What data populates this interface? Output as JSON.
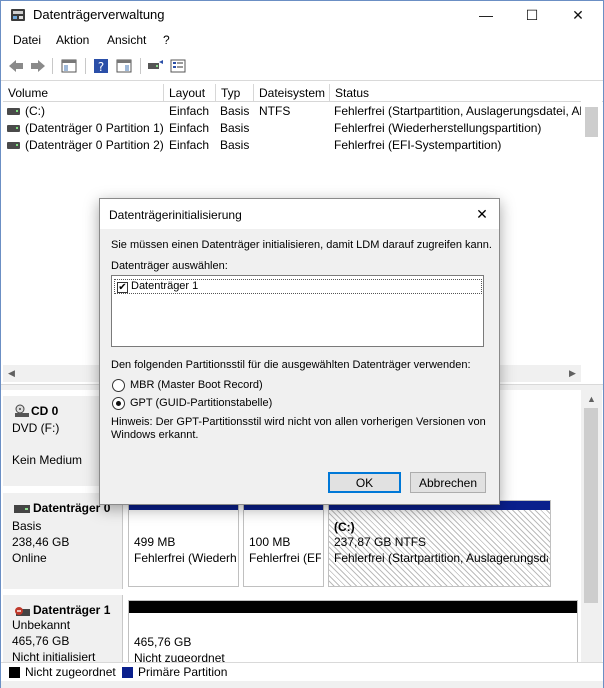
{
  "window": {
    "title": "Datenträgerverwaltung",
    "min_glyph": "—",
    "max_glyph": "☐",
    "close_glyph": "✕"
  },
  "menu": [
    "Datei",
    "Aktion",
    "Ansicht",
    "?"
  ],
  "toolbar_icons": [
    "back-icon",
    "forward-icon",
    "console-tree-icon",
    "help-icon",
    "properties-icon",
    "rescan-icon",
    "disk-list-icon"
  ],
  "table": {
    "columns": [
      "Volume",
      "Layout",
      "Typ",
      "Dateisystem",
      "Status"
    ],
    "rows": [
      [
        "(C:)",
        "Einfach",
        "Basis",
        "NTFS",
        "Fehlerfrei (Startpartition, Auslagerungsdatei, Absturzabbild, Primäre Partition)"
      ],
      [
        "(Datenträger 0 Partition 1)",
        "Einfach",
        "Basis",
        "",
        "Fehlerfrei (Wiederherstellungspartition)"
      ],
      [
        "(Datenträger 0 Partition 2)",
        "Einfach",
        "Basis",
        "",
        "Fehlerfrei (EFI-Systempartition)"
      ]
    ]
  },
  "disks": {
    "cd0": {
      "name": "CD 0",
      "lines": [
        "DVD (F:)",
        "",
        "Kein Medium"
      ]
    },
    "disk0": {
      "name": "Datenträger 0",
      "lines": [
        "Basis",
        "238,46 GB",
        "Online"
      ],
      "partitions": [
        {
          "title": "",
          "size": "499 MB",
          "status": "Fehlerfrei (Wiederherstellungspartition)"
        },
        {
          "title": "",
          "size": "100 MB",
          "status": "Fehlerfrei (EFI-Systempartition)"
        },
        {
          "title": "(C:)",
          "size": "237,87 GB NTFS",
          "status": "Fehlerfrei (Startpartition, Auslagerungsdatei, Absturzabbild)"
        }
      ]
    },
    "disk1": {
      "name": "Datenträger 1",
      "lines": [
        "Unbekannt",
        "465,76 GB",
        "Nicht initialisiert"
      ],
      "partitions": [
        {
          "size": "465,76 GB",
          "status": "Nicht zugeordnet"
        }
      ]
    }
  },
  "legend": [
    {
      "label": "Nicht zugeordnet",
      "color": "#000000"
    },
    {
      "label": "Primäre Partition",
      "color": "#0a1f8c"
    }
  ],
  "dialog": {
    "title": "Datenträgerinitialisierung",
    "intro": "Sie müssen einen Datenträger initialisieren, damit LDM darauf zugreifen kann.",
    "select_label": "Datenträger auswählen:",
    "disk_entry": "Datenträger 1",
    "check_glyph": "✔",
    "style_label": "Den folgenden Partitionsstil für die ausgewählten Datenträger verwenden:",
    "option_mbr": "MBR (Master Boot Record)",
    "option_gpt": "GPT (GUID-Partitionstabelle)",
    "hint_line1": "Hinweis: Der GPT-Partitionsstil wird nicht von allen vorherigen Versionen von",
    "hint_line2": "Windows erkannt.",
    "ok": "OK",
    "cancel": "Abbrechen"
  }
}
